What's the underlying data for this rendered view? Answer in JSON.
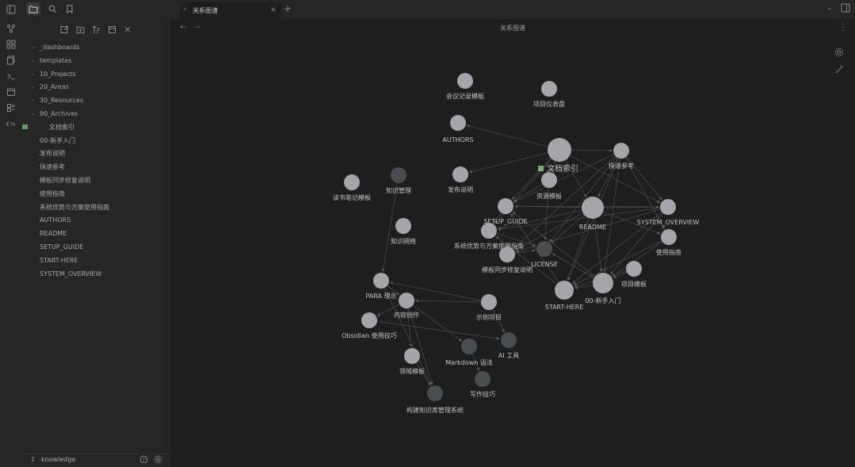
{
  "ribbon": {
    "icons": [
      "graph-icon",
      "canvas-icon",
      "pages-icon",
      "terminal-icon",
      "calendar-icon",
      "template-icon",
      "code-icon"
    ]
  },
  "sidebar": {
    "tree": [
      {
        "label": "_dashboards",
        "type": "folder"
      },
      {
        "label": "templates",
        "type": "folder"
      },
      {
        "label": "10_Projects",
        "type": "folder"
      },
      {
        "label": "20_Areas",
        "type": "folder"
      },
      {
        "label": "30_Resources",
        "type": "folder"
      },
      {
        "label": "90_Archives",
        "type": "folder"
      },
      {
        "label": "文档索引",
        "type": "file"
      },
      {
        "label": "00-新手入门",
        "type": "file"
      },
      {
        "label": "发布说明",
        "type": "file"
      },
      {
        "label": "快速参考",
        "type": "file"
      },
      {
        "label": "模板同步修复说明",
        "type": "file"
      },
      {
        "label": "使用指南",
        "type": "file"
      },
      {
        "label": "系统优势与方案使用指南",
        "type": "file"
      },
      {
        "label": "AUTHORS",
        "type": "file"
      },
      {
        "label": "README",
        "type": "file"
      },
      {
        "label": "SETUP_GUIDE",
        "type": "file"
      },
      {
        "label": "START-HERE",
        "type": "file"
      },
      {
        "label": "SYSTEM_OVERVIEW",
        "type": "file"
      }
    ],
    "vault_name": "knowledge"
  },
  "tab": {
    "title": "关系图谱"
  },
  "view": {
    "title": "关系图谱"
  },
  "graph": {
    "nodes": [
      {
        "id": "n1",
        "label": "会议记录模板"
      },
      {
        "id": "n2",
        "label": "项目仪表盘"
      },
      {
        "id": "n3",
        "label": "AUTHORS"
      },
      {
        "id": "n4",
        "label": "文档索引"
      },
      {
        "id": "n5",
        "label": "快速参考"
      },
      {
        "id": "n6",
        "label": "读书笔记模板"
      },
      {
        "id": "n7",
        "label": "知识管理"
      },
      {
        "id": "n8",
        "label": "发布说明"
      },
      {
        "id": "n9",
        "label": "资源模板"
      },
      {
        "id": "n10",
        "label": "SETUP_GUIDE"
      },
      {
        "id": "n11",
        "label": "README"
      },
      {
        "id": "n12",
        "label": "SYSTEM_OVERVIEW"
      },
      {
        "id": "n13",
        "label": "知识网络"
      },
      {
        "id": "n14",
        "label": "系统优势与方案使用指南"
      },
      {
        "id": "n15",
        "label": "使用指南"
      },
      {
        "id": "n16",
        "label": "LICENSE"
      },
      {
        "id": "n17",
        "label": "模板同步修复说明"
      },
      {
        "id": "n18",
        "label": "项目模板"
      },
      {
        "id": "n19",
        "label": "PARA 理念"
      },
      {
        "id": "n20",
        "label": "START-HERE"
      },
      {
        "id": "n21",
        "label": "00-新手入门"
      },
      {
        "id": "n22",
        "label": "内容创作"
      },
      {
        "id": "n23",
        "label": "示例项目"
      },
      {
        "id": "n24",
        "label": "Obsidian 使用技巧"
      },
      {
        "id": "n25",
        "label": "AI 工具"
      },
      {
        "id": "n26",
        "label": "Markdown 语法"
      },
      {
        "id": "n27",
        "label": "领域模板"
      },
      {
        "id": "n28",
        "label": "写作技巧"
      },
      {
        "id": "n29",
        "label": "构建知识库管理系统"
      }
    ]
  }
}
